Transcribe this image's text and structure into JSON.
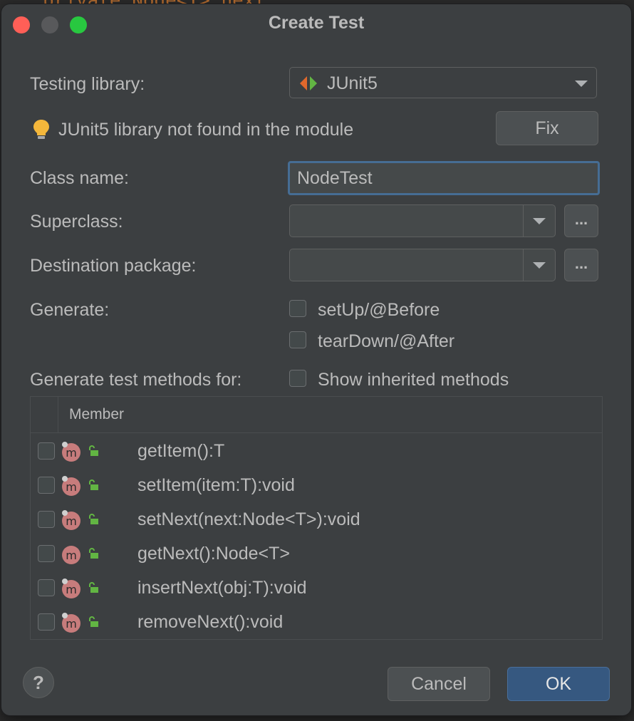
{
  "background": {
    "code_text": "private Node<T> next;"
  },
  "dialog": {
    "title": "Create Test",
    "testing_library": {
      "label": "Testing library:",
      "selected": "JUnit5",
      "icon": "junit-arrows-icon"
    },
    "warning": {
      "icon": "lightbulb-icon",
      "text": "JUnit5 library not found in the module",
      "fix_button": "Fix"
    },
    "class_name": {
      "label": "Class name:",
      "value": "NodeTest"
    },
    "superclass": {
      "label": "Superclass:",
      "value": "",
      "browse": "..."
    },
    "destination_package": {
      "label": "Destination package:",
      "value": "",
      "browse": "..."
    },
    "generate": {
      "label": "Generate:",
      "options": [
        {
          "label": "setUp/@Before",
          "checked": false
        },
        {
          "label": "tearDown/@After",
          "checked": false
        }
      ]
    },
    "test_methods": {
      "label": "Generate test methods for:",
      "show_inherited": {
        "label": "Show inherited methods",
        "checked": false
      },
      "column_header": "Member",
      "members": [
        {
          "signature": "getItem():T",
          "checked": false
        },
        {
          "signature": "setItem(item:T):void",
          "checked": false
        },
        {
          "signature": "setNext(next:Node<T>):void",
          "checked": false
        },
        {
          "signature": "getNext():Node<T>",
          "checked": false
        },
        {
          "signature": "insertNext(obj:T):void",
          "checked": false
        },
        {
          "signature": "removeNext():void",
          "checked": false
        }
      ]
    },
    "help": "?",
    "cancel": "Cancel",
    "ok": "OK"
  },
  "colors": {
    "dialog_bg": "#3c3f41",
    "primary_button": "#365880",
    "focus_border": "#466d94",
    "method_icon": "#c77c7c",
    "lock_icon": "#62b543",
    "close": "#ff5f57",
    "maximize": "#28c840"
  }
}
